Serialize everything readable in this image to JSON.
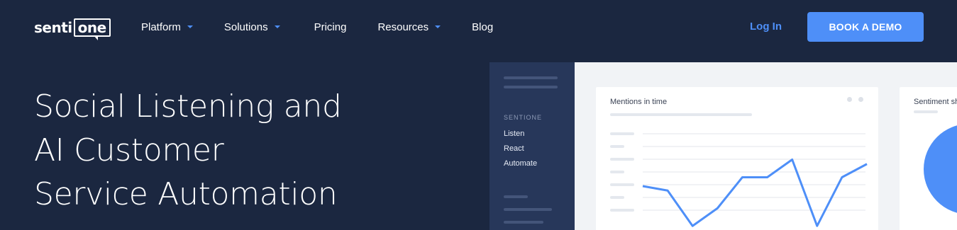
{
  "brand": {
    "left": "senti",
    "boxed": "one"
  },
  "nav": {
    "items": [
      {
        "label": "Platform",
        "dropdown": true
      },
      {
        "label": "Solutions",
        "dropdown": true
      },
      {
        "label": "Pricing",
        "dropdown": false
      },
      {
        "label": "Resources",
        "dropdown": true
      },
      {
        "label": "Blog",
        "dropdown": false
      }
    ],
    "login": "Log In",
    "cta": "BOOK A DEMO"
  },
  "hero": {
    "lines": [
      "Social Listening and",
      "AI Customer",
      "Service Automation"
    ]
  },
  "mockup": {
    "sidebar": {
      "section": "SENTIONE",
      "links": [
        "Listen",
        "React",
        "Automate"
      ]
    },
    "chart1": {
      "title": "Mentions in time"
    },
    "chart2": {
      "title": "Sentiment sh"
    },
    "chart_data": {
      "type": "line",
      "values": [
        12,
        11,
        3,
        7,
        14,
        14,
        18,
        3,
        14,
        17
      ],
      "ylim": [
        0,
        24
      ],
      "color": "#4e8ff8"
    }
  },
  "colors": {
    "background": "#1b2740",
    "accent": "#4e8ff8",
    "sidebar": "#27375a"
  }
}
